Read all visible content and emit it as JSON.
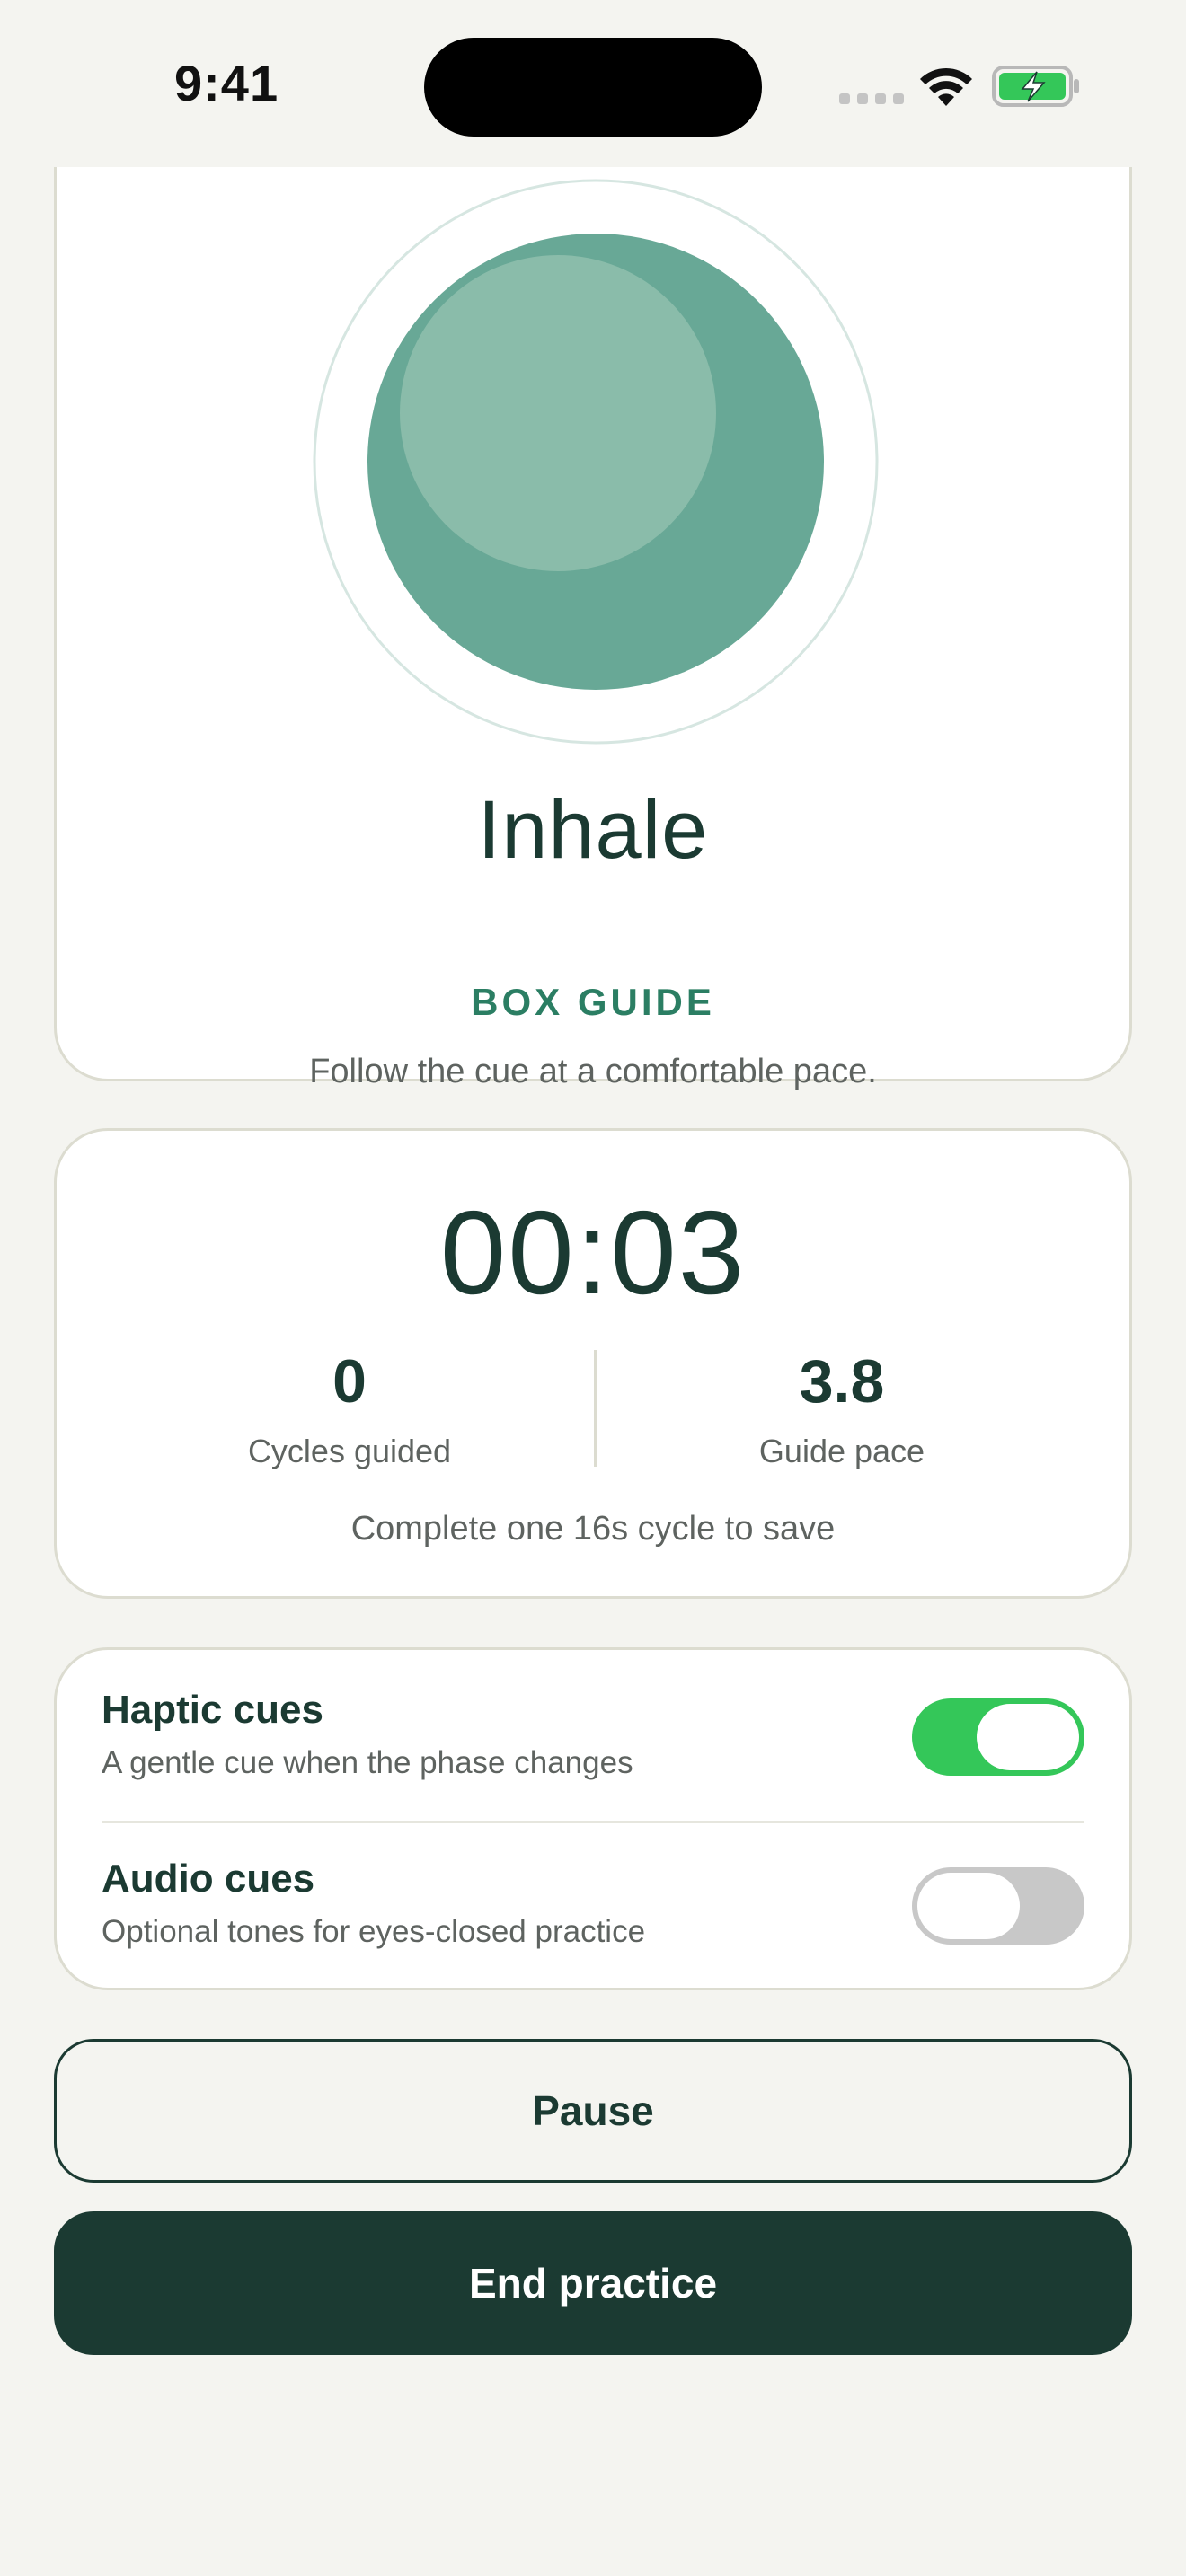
{
  "status_bar": {
    "time": "9:41",
    "wifi_icon": "wifi-icon",
    "battery_icon": "battery-charging-icon"
  },
  "breath": {
    "phase": "Inhale",
    "guide": "BOX GUIDE",
    "hint": "Follow the cue at a comfortable pace.",
    "orb_color": "#68a896",
    "orb_highlight_color": "#8abcaa",
    "ring_color": "#d6e6e1"
  },
  "timer": {
    "elapsed": "00:03",
    "cycles_value": "0",
    "cycles_label": "Cycles guided",
    "pace_value": "3.8",
    "pace_label": "Guide pace",
    "save_hint": "Complete one 16s cycle to save"
  },
  "cues": {
    "haptic": {
      "title": "Haptic cues",
      "subtitle": "A gentle cue when the phase changes",
      "enabled": true
    },
    "audio": {
      "title": "Audio cues",
      "subtitle": "Optional tones for eyes-closed practice",
      "enabled": false
    }
  },
  "actions": {
    "pause_label": "Pause",
    "end_label": "End practice"
  },
  "colors": {
    "accent": "#2b7e63",
    "primary_dark": "#1b3a32",
    "toggle_on": "#34c759",
    "background": "#f4f4f0"
  }
}
